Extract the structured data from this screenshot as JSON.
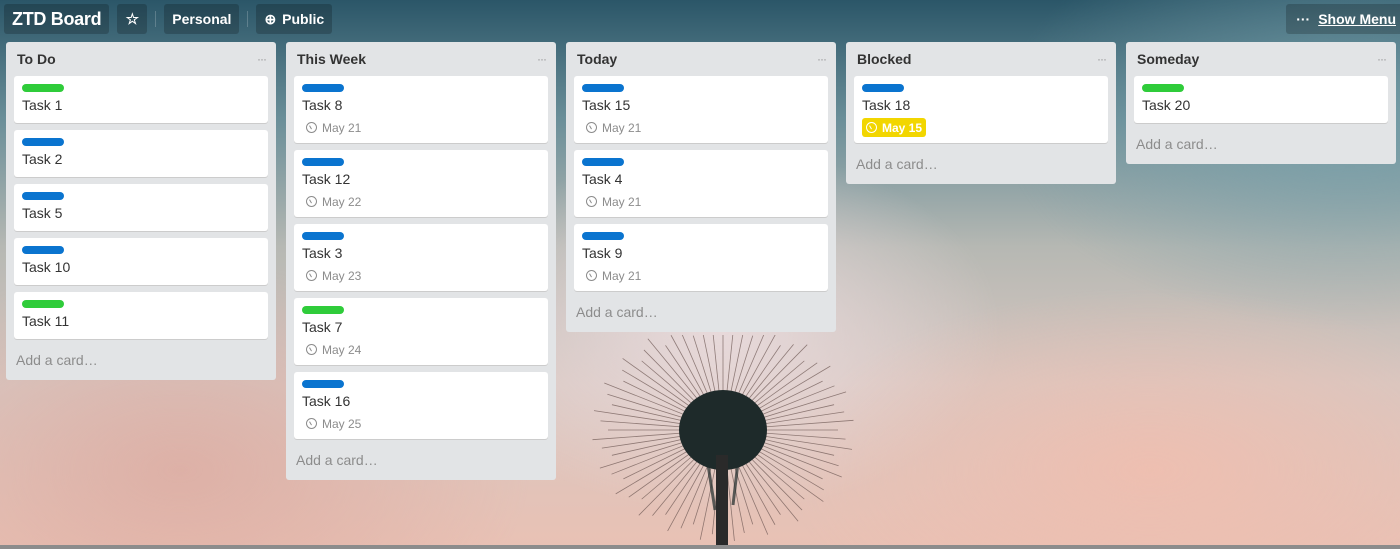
{
  "header": {
    "board_title": "ZTD Board",
    "star_icon": "star-icon",
    "team_label": "Personal",
    "visibility_label": "Public",
    "visibility_icon": "globe-icon",
    "show_menu_label": "Show Menu",
    "show_menu_icon": "ellipsis-icon"
  },
  "colors": {
    "label_green": "#2fcc3a",
    "label_blue": "#0a74cf",
    "overdue": "#f2d600",
    "list_bg": "#e2e4e6"
  },
  "lists": [
    {
      "title": "To Do",
      "menu_icon": "ellipsis-icon",
      "add_card": "Add a card…",
      "cards": [
        {
          "label": "green",
          "title": "Task 1"
        },
        {
          "label": "blue",
          "title": "Task 2"
        },
        {
          "label": "blue",
          "title": "Task 5"
        },
        {
          "label": "blue",
          "title": "Task 10"
        },
        {
          "label": "green",
          "title": "Task 11"
        }
      ]
    },
    {
      "title": "This Week",
      "menu_icon": "ellipsis-icon",
      "add_card": "Add a card…",
      "cards": [
        {
          "label": "blue",
          "title": "Task 8",
          "due": "May 21"
        },
        {
          "label": "blue",
          "title": "Task 12",
          "due": "May 22"
        },
        {
          "label": "blue",
          "title": "Task 3",
          "due": "May 23"
        },
        {
          "label": "green",
          "title": "Task 7",
          "due": "May 24"
        },
        {
          "label": "blue",
          "title": "Task 16",
          "due": "May 25"
        }
      ]
    },
    {
      "title": "Today",
      "menu_icon": "ellipsis-icon",
      "add_card": "Add a card…",
      "cards": [
        {
          "label": "blue",
          "title": "Task 15",
          "due": "May 21"
        },
        {
          "label": "blue",
          "title": "Task 4",
          "due": "May 21"
        },
        {
          "label": "blue",
          "title": "Task 9",
          "due": "May 21"
        }
      ]
    },
    {
      "title": "Blocked",
      "menu_icon": "ellipsis-icon",
      "add_card": "Add a card…",
      "cards": [
        {
          "label": "blue",
          "title": "Task 18",
          "due": "May 15",
          "overdue": true
        }
      ]
    },
    {
      "title": "Someday",
      "menu_icon": "ellipsis-icon",
      "add_card": "Add a card…",
      "cards": [
        {
          "label": "green",
          "title": "Task 20"
        }
      ]
    }
  ]
}
